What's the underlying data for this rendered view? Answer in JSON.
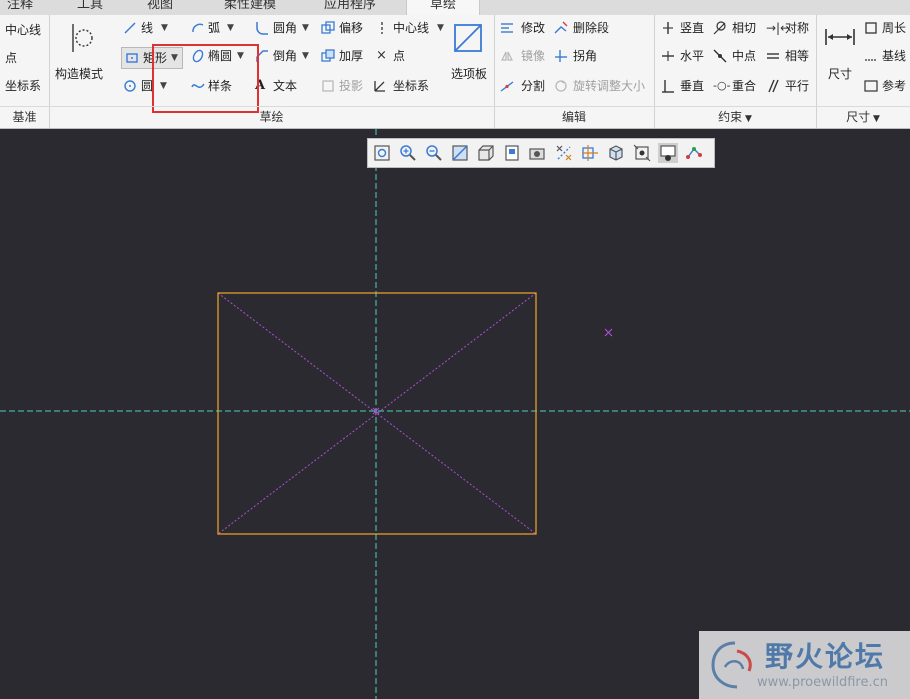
{
  "tabs": [
    "注释",
    "工具",
    "视图",
    "柔性建模",
    "应用程序",
    "草绘"
  ],
  "active_tab": "草绘",
  "groups": {
    "datum": {
      "label": "基准",
      "items": [
        "中心线",
        "点",
        "坐标系"
      ]
    },
    "sketch": {
      "label": "草绘",
      "construction_mode": "构造模式",
      "line": "线",
      "arc": "弧",
      "rectangle": "矩形",
      "ellipse": "椭圆",
      "circle": "圆",
      "spline": "样条",
      "fillet": "圆角",
      "chamfer": "倒角",
      "text": "文本",
      "offset": "偏移",
      "thicken": "加厚",
      "project": "投影",
      "centerline": "中心线",
      "point": "点",
      "coordinate_system": "坐标系",
      "palette": "选项板"
    },
    "edit": {
      "label": "编辑",
      "modify": "修改",
      "delete_segment": "删除段",
      "mirror": "镜像",
      "corner": "拐角",
      "divide": "分割",
      "rotate_resize": "旋转调整大小"
    },
    "constrain": {
      "label": "约束",
      "vertical": "竖直",
      "tangent": "相切",
      "symmetric": "对称",
      "horizontal": "水平",
      "midpoint": "中点",
      "equal": "相等",
      "perpendicular": "垂直",
      "coincident": "重合",
      "parallel": "平行"
    },
    "dimension": {
      "label": "尺寸",
      "dimension": "尺寸",
      "perimeter": "周长",
      "baseline": "基线",
      "reference": "参考"
    }
  },
  "view_toolbar": [
    "refit-icon",
    "zoom-in-icon",
    "zoom-out-icon",
    "repaint-icon",
    "display-style-icon",
    "saved-orientations-icon",
    "view-manager-icon",
    "sketch-display-filters-icon",
    "datum-display-icon",
    "spin-center-icon",
    "perspective-icon",
    "sketch-view-icon",
    "annotation-display-icon"
  ],
  "watermark": {
    "title": "野火论坛",
    "url": "www.proewildfire.cn"
  },
  "colors": {
    "rectangle": "#f2a52a",
    "centerline": "#4fd0c0",
    "diagonal": "#b04ed6",
    "highlight": "#e03030"
  }
}
